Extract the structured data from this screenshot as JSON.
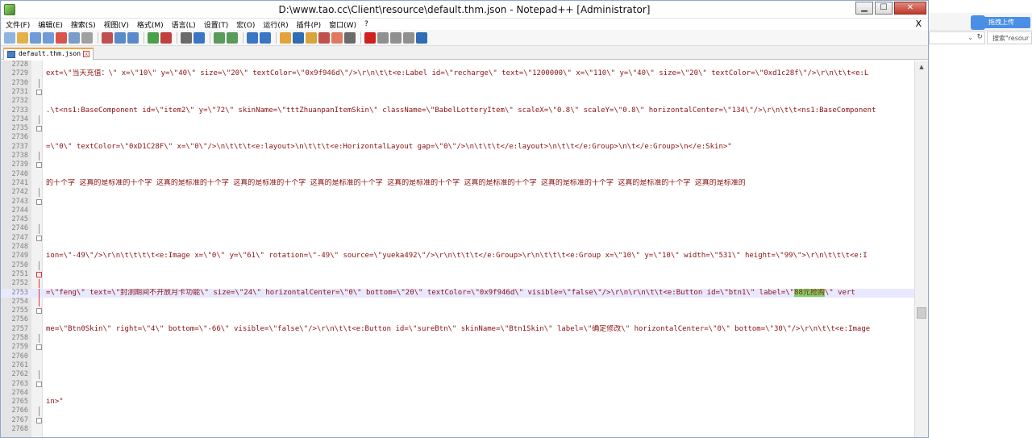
{
  "window": {
    "title": "D:\\www.tao.cc\\Client\\resource\\default.thm.json - Notepad++ [Administrator]",
    "min": "▁",
    "max": "☐",
    "close": "✕"
  },
  "menu": [
    "文件(F)",
    "编辑(E)",
    "搜索(S)",
    "视图(V)",
    "格式(M)",
    "语言(L)",
    "设置(T)",
    "宏(O)",
    "运行(R)",
    "插件(P)",
    "窗口(W)",
    "?"
  ],
  "menu_close": "X",
  "tab": {
    "label": "default.thm.json",
    "close": "x"
  },
  "editor": {
    "highlighted": "88元抢购",
    "lines": [
      {
        "n": "2728",
        "t": "",
        "f": ""
      },
      {
        "n": "2729",
        "t": "ext=\\\"当天充值：\\\" x=\\\"10\\\" y=\\\"40\\\" size=\\\"20\\\" textColor=\\\"0x9f946d\\\"/>\\r\\n\\t\\t<e:Label id=\\\"recharge\\\" text=\\\"1200000\\\" x=\\\"110\\\" y=\\\"40\\\" size=\\\"20\\\" textColor=\\\"0xd1c28f\\\"/>\\r\\n\\t\\t<e:L",
        "f": ""
      },
      {
        "n": "2730",
        "t": "",
        "f": "bar"
      },
      {
        "n": "2731",
        "t": "",
        "f": "box"
      },
      {
        "n": "2732",
        "t": "",
        "f": ""
      },
      {
        "n": "2733",
        "t": ".\\t<ns1:BaseComponent id=\\\"item2\\\" y=\\\"72\\\" skinName=\\\"tttZhuanpanItemSkin\\\" className=\\\"BabelLotteryItem\\\" scaleX=\\\"0.8\\\" scaleY=\\\"0.8\\\" horizontalCenter=\\\"134\\\"/>\\r\\n\\t\\t<ns1:BaseComponent",
        "f": ""
      },
      {
        "n": "2734",
        "t": "",
        "f": "bar"
      },
      {
        "n": "2735",
        "t": "",
        "f": "box"
      },
      {
        "n": "2736",
        "t": "",
        "f": ""
      },
      {
        "n": "2737",
        "t": "=\\\"0\\\" textColor=\\\"0xD1C28F\\\" x=\\\"0\\\"/>\\n\\t\\t\\t<e:layout>\\n\\t\\t\\t<e:HorizontalLayout gap=\\\"0\\\"/>\\n\\t\\t\\t</e:layout>\\n\\t\\t</e:Group>\\n\\t</e:Group>\\n</e:Skin>\"",
        "f": ""
      },
      {
        "n": "2738",
        "t": "",
        "f": "bar"
      },
      {
        "n": "2739",
        "t": "",
        "f": "box"
      },
      {
        "n": "2740",
        "t": "",
        "f": ""
      },
      {
        "n": "2741",
        "t": "的十个字 这真的是标准的十个字 这真的是标准的十个字 这真的是标准的十个字 这真的是标准的十个字 这真的是标准的十个字 这真的是标准的十个字 这真的是标准的十个字 这真的是标准的十个字 这真的是标准的",
        "f": ""
      },
      {
        "n": "2742",
        "t": "",
        "f": "bar"
      },
      {
        "n": "2743",
        "t": "",
        "f": "box"
      },
      {
        "n": "2744",
        "t": "",
        "f": ""
      },
      {
        "n": "2745",
        "t": "",
        "f": ""
      },
      {
        "n": "2746",
        "t": "",
        "f": "bar"
      },
      {
        "n": "2747",
        "t": "",
        "f": "box"
      },
      {
        "n": "2748",
        "t": "",
        "f": ""
      },
      {
        "n": "2749",
        "t": "ion=\\\"-49\\\"/>\\r\\n\\t\\t\\t\\t<e:Image x=\\\"0\\\" y=\\\"61\\\" rotation=\\\"-49\\\" source=\\\"yueka492\\\"/>\\r\\n\\t\\t\\t</e:Group>\\r\\n\\t\\t\\t<e:Group x=\\\"10\\\" y=\\\"10\\\" width=\\\"531\\\" height=\\\"99\\\">\\r\\n\\t\\t\\t<e:I",
        "f": ""
      },
      {
        "n": "2750",
        "t": "",
        "f": "bar"
      },
      {
        "n": "2751",
        "t": "",
        "f": "boxred"
      },
      {
        "n": "2752",
        "t": "",
        "f": "barred"
      },
      {
        "n": "2753",
        "t": "=\\\"feng\\\" text=\\\"封测期间不开放月卡功能\\\" size=\\\"24\\\" horizontalCenter=\\\"0\\\" bottom=\\\"20\\\" textColor=\\\"0x9f946d\\\" visible=\\\"false\\\"/>\\r\\n\\r\\n\\t\\t<e:Button id=\\\"btn1\\\" label=\\\"",
        "t2": "\\\" vert",
        "f": "barred",
        "cur": true
      },
      {
        "n": "2754",
        "t": "",
        "f": "barred"
      },
      {
        "n": "2755",
        "t": "",
        "f": "box"
      },
      {
        "n": "2756",
        "t": "",
        "f": ""
      },
      {
        "n": "2757",
        "t": "me=\\\"Btn0Skin\\\" right=\\\"4\\\" bottom=\\\"-66\\\" visible=\\\"false\\\"/>\\r\\n\\t\\t<e:Button id=\\\"sureBtn\\\" skinName=\\\"Btn1Skin\\\" label=\\\"确定修改\\\" horizontalCenter=\\\"0\\\" bottom=\\\"30\\\"/>\\r\\n\\t\\t<e:Image",
        "f": ""
      },
      {
        "n": "2758",
        "t": "",
        "f": "bar"
      },
      {
        "n": "2759",
        "t": "",
        "f": "box"
      },
      {
        "n": "2760",
        "t": "",
        "f": ""
      },
      {
        "n": "2761",
        "t": "",
        "f": ""
      },
      {
        "n": "2762",
        "t": "",
        "f": "bar"
      },
      {
        "n": "2763",
        "t": "",
        "f": "box"
      },
      {
        "n": "2764",
        "t": "",
        "f": ""
      },
      {
        "n": "2765",
        "t": "in>\"",
        "f": ""
      },
      {
        "n": "2766",
        "t": "",
        "f": "bar"
      },
      {
        "n": "2767",
        "t": "",
        "f": "box"
      },
      {
        "n": "2768",
        "t": "",
        "f": ""
      }
    ]
  },
  "browser": {
    "upload": "拖拽上传",
    "search_placeholder": "搜索\"resour",
    "refresh": "↻",
    "dropdown": "⌄"
  }
}
